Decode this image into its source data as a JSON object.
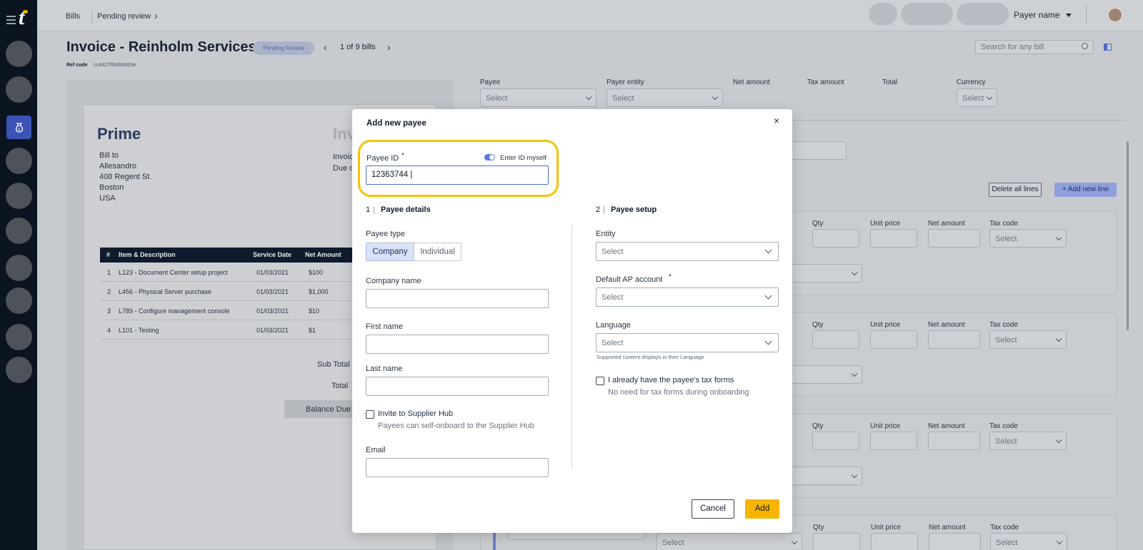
{
  "topbar": {
    "crumbs": [
      "Bills",
      "Pending review"
    ],
    "payer_name": "Payer name"
  },
  "page": {
    "title": "Invoice - Reinholm Services",
    "status": "Pending Review",
    "bill_counter": "1 of 9 bills",
    "ref_label": "Ref code",
    "ref_value": "cc4427f5b9b6463e",
    "search_placeholder": "Search for any bill"
  },
  "invoice": {
    "company": "Prime",
    "doc_word": "Inv",
    "bill_to": [
      "Bill to",
      "Allesandro",
      "408 Regent St.",
      "Boston",
      "USA"
    ],
    "meta": [
      "Invoic",
      "Due d"
    ],
    "columns": [
      "#",
      "Item & Description",
      "Service Date",
      "Net Amount"
    ],
    "rows": [
      [
        "1",
        "L123 - Document Center setup project",
        "01/03/2021",
        "$100"
      ],
      [
        "2",
        "L456 - Physical Server purchase",
        "01/03/2021",
        "$1,000"
      ],
      [
        "3",
        "L789 - Configure management console",
        "01/03/2021",
        "$10"
      ],
      [
        "4",
        "L101 - Testing",
        "01/03/2021",
        "$1"
      ]
    ],
    "sub_total": "Sub Total",
    "total": "Total",
    "balance_due": "Balance Due"
  },
  "form": {
    "headers": {
      "payee": "Payee",
      "payer_entity": "Payer entity",
      "net_amount": "Net amount",
      "tax_amount": "Tax amount",
      "total": "Total",
      "currency": "Currency"
    },
    "select_placeholder": "Select",
    "delete_all": "Delete all lines",
    "add_line": "+ Add new line",
    "line_labels": {
      "qty": "Qty",
      "unit_price": "Unit price",
      "net_amount": "Net amount",
      "tax_code": "Tax code"
    }
  },
  "modal": {
    "title": "Add new payee",
    "close": "×",
    "payee_id_label": "Payee ID",
    "required_mark": "*",
    "toggle_label": "Enter ID myself",
    "toggle_on": true,
    "payee_id_value": "12363744 |",
    "section1_num": "1",
    "section1_title": "Payee details",
    "section2_num": "2",
    "section2_title": "Payee setup",
    "payee_type_label": "Payee type",
    "payee_type_options": [
      "Company",
      "Individual"
    ],
    "payee_type_selected": "Company",
    "company_name_label": "Company name",
    "first_name_label": "First name",
    "last_name_label": "Last name",
    "invite_label": "Invite to Supplier Hub",
    "invite_helper": "Payees can self-onboard to the Supplier Hub",
    "email_label": "Email",
    "entity_label": "Entity",
    "entity_placeholder": "Select",
    "ap_account_label": "Default AP account",
    "ap_account_placeholder": "Select",
    "language_label": "Language",
    "language_placeholder": "Select",
    "language_hint": "Supported content displays in their Language",
    "tax_forms_label": "I already have the payee's tax forms",
    "tax_forms_helper": "No need for tax forms during onboarding",
    "cancel": "Cancel",
    "add": "Add"
  },
  "colors": {
    "rail": "#0b1522",
    "accent": "#4b6bd6",
    "highlight": "#f5c400",
    "primary_button": "#f7b500"
  }
}
